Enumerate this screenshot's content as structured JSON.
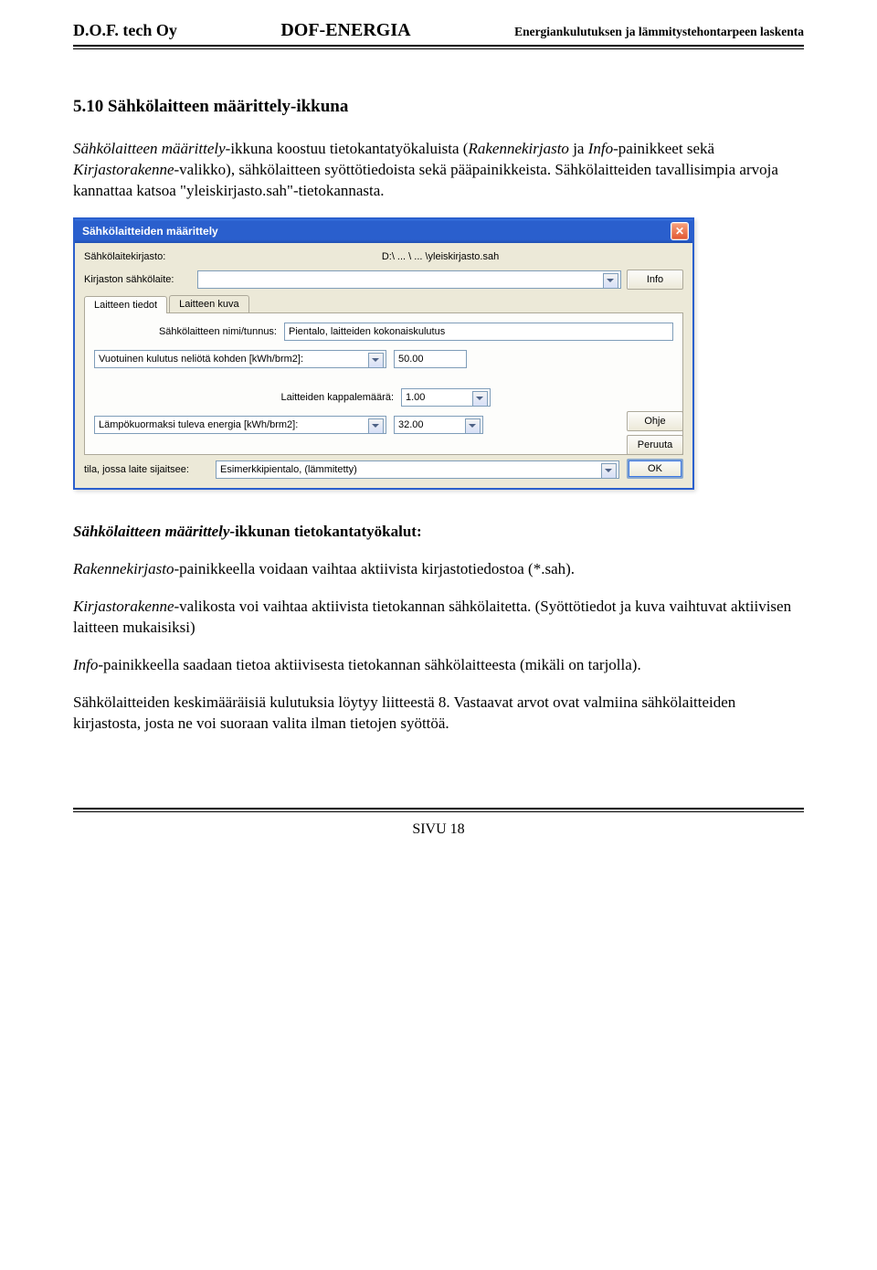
{
  "header": {
    "left": "D.O.F. tech Oy",
    "center": "DOF-ENERGIA",
    "right": "Energiankulutuksen ja lämmitystehontarpeen laskenta"
  },
  "section": {
    "title": "5.10 Sähkölaitteen määrittely-ikkuna",
    "intro_1a": "Sähkölaitteen määrittely",
    "intro_1b": "-ikkuna koostuu tietokantatyökaluista (",
    "intro_1c": "Rakennekirjasto",
    "intro_1d": " ja ",
    "intro_1e": "Info",
    "intro_1f": "-painikkeet sekä ",
    "intro_1g": "Kirjastorakenne",
    "intro_1h": "-valikko), sähkölaitteen syöttötiedoista sekä pääpainikkeista. Sähkölaitteiden tavallisimpia arvoja kannattaa katsoa \"yleiskirjasto.sah\"-tietokannasta."
  },
  "dialog": {
    "title": "Sähkölaitteiden määrittely",
    "lib_label": "Sähkölaitekirjasto:",
    "lib_value": "D:\\ ... \\ ... \\yleiskirjasto.sah",
    "listlbl": "Kirjaston sähkölaite:",
    "list_value": "",
    "btn_info": "Info",
    "tabs": {
      "tab1": "Laitteen tiedot",
      "tab2": "Laitteen kuva"
    },
    "name_label": "Sähkölaitteen nimi/tunnus:",
    "name_value": "Pientalo, laitteiden kokonaiskulutus",
    "annual_label": "Vuotuinen kulutus neliötä kohden [kWh/brm2]:",
    "annual_value": "50.00",
    "count_label": "Laitteiden kappalemäärä:",
    "count_value": "1.00",
    "heat_label": "Lämpökuormaksi tuleva energia [kWh/brm2]:",
    "heat_value": "32.00",
    "btn_ohje": "Ohje",
    "btn_peruuta": "Peruuta",
    "btn_ok": "OK",
    "room_label": "tila, jossa laite sijaitsee:",
    "room_value": "Esimerkkipientalo, (lämmitetty)"
  },
  "after": {
    "subheading_a": "Sähkölaitteen määrittely",
    "subheading_b": "-ikkunan tietokantatyökalut:",
    "p1a": "Rakennekirjasto",
    "p1b": "-painikkeella voidaan vaihtaa aktiivista kirjastotiedostoa (*.sah).",
    "p2a": "Kirjastorakenne",
    "p2b": "-valikosta voi vaihtaa aktiivista tietokannan sähkölaitetta. (Syöttötiedot ja kuva vaihtuvat aktiivisen laitteen mukaisiksi)",
    "p3a": "Info",
    "p3b": "-painikkeella saadaan tietoa aktiivisesta tietokannan sähkölaitteesta (mikäli on tarjolla).",
    "p4": "Sähkölaitteiden keskimääräisiä kulutuksia löytyy liitteestä 8. Vastaavat arvot ovat valmiina sähkölaitteiden kirjastosta, josta ne voi suoraan valita ilman tietojen syöttöä."
  },
  "footer": {
    "page": "SIVU 18"
  }
}
